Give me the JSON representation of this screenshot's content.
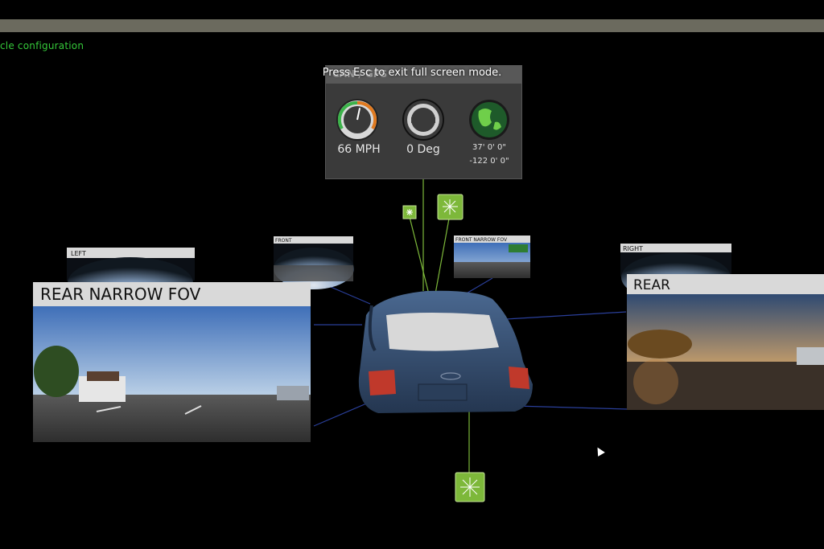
{
  "app": {
    "menu_label": "cle configuration",
    "fullscreen_notice": "Press Esc to exit full screen mode."
  },
  "hud": {
    "header_title": "CAN / GPS",
    "speed": "66 MPH",
    "steering": "0 Deg",
    "latitude": "37' 0' 0\"",
    "longitude": "-122 0' 0\"",
    "speed_fraction": 0.55
  },
  "cameras": {
    "left": {
      "title": "LEFT"
    },
    "front": {
      "title": "FRONT"
    },
    "front_narrow": {
      "title": "FRONT NARROW FOV"
    },
    "right": {
      "title": "RIGHT"
    },
    "rear_narrow": {
      "title": "REAR NARROW FOV"
    },
    "rear": {
      "title": "REAR"
    }
  },
  "colors": {
    "accent_green": "#35c93a",
    "sensor_green": "#7db83a",
    "link_blue": "#2a3f9a",
    "car_blue": "#3f5a80"
  },
  "icons": [
    "sensor-burst-icon",
    "speedometer-icon",
    "steering-wheel-icon",
    "globe-icon",
    "mouse-cursor-icon"
  ]
}
